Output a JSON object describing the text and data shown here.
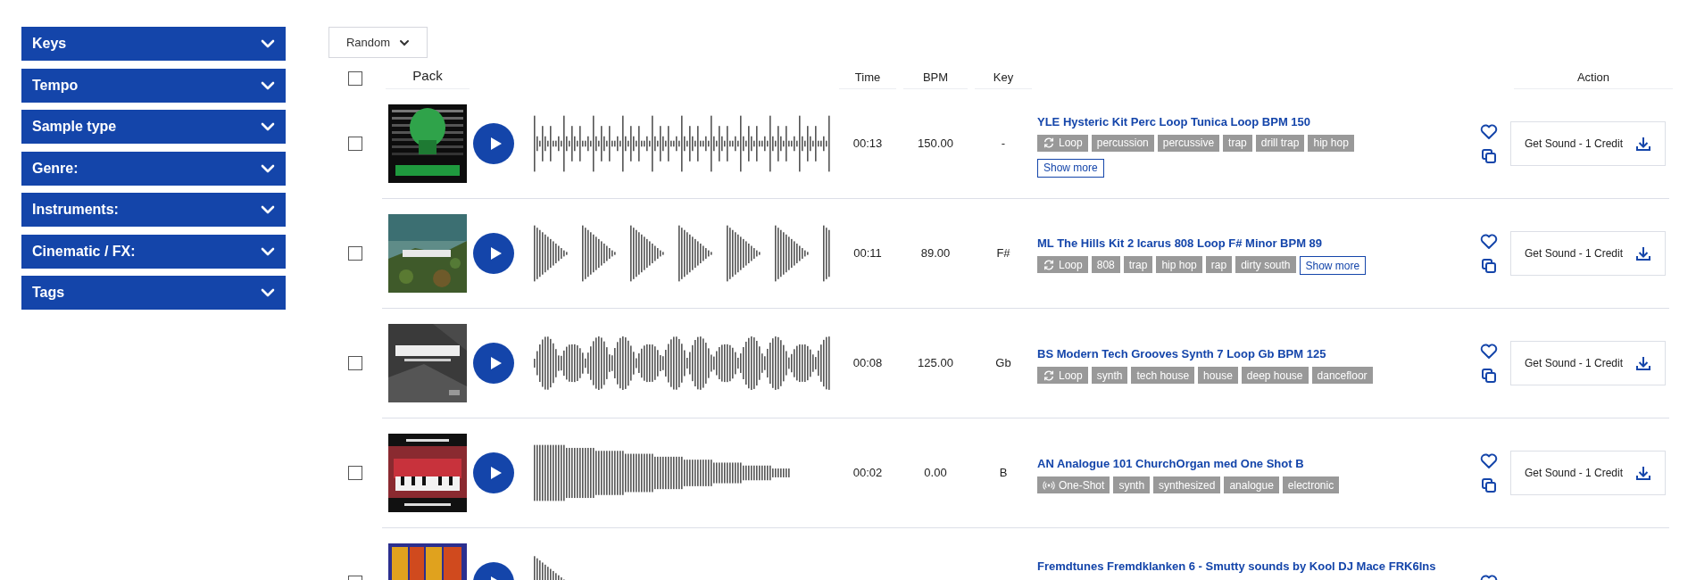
{
  "filters": [
    {
      "label": "Keys",
      "expanded": false
    },
    {
      "label": "Tempo",
      "expanded": false
    },
    {
      "label": "Sample type",
      "expanded": false
    },
    {
      "label": "Genre:",
      "expanded": false
    },
    {
      "label": "Instruments:",
      "expanded": false
    },
    {
      "label": "Cinematic / FX:",
      "expanded": false
    },
    {
      "label": "Tags",
      "expanded": false
    }
  ],
  "sort": {
    "value": "Random"
  },
  "table": {
    "select_all": {
      "checked": false
    },
    "columns": [
      "Pack",
      "Time",
      "BPM",
      "Key",
      "Action"
    ],
    "rows": [
      {
        "selected": false,
        "time": "00:13",
        "bpm": "150.00",
        "key": "-",
        "title": "YLE Hysteric Kit Perc Loop Tunica Loop BPM 150",
        "tags": [
          {
            "label": "Loop",
            "kind": "loop"
          },
          {
            "label": "percussion",
            "kind": "plain"
          },
          {
            "label": "percussive",
            "kind": "plain"
          },
          {
            "label": "trap",
            "kind": "plain"
          },
          {
            "label": "drill trap",
            "kind": "plain"
          },
          {
            "label": "hip hop",
            "kind": "plain"
          }
        ],
        "show_more": "Show more",
        "show_more_wrapped": true,
        "action": "Get Sound - 1 Credit"
      },
      {
        "selected": false,
        "time": "00:11",
        "bpm": "89.00",
        "key": "F#",
        "title": "ML The Hills Kit 2 Icarus 808 Loop F# Minor BPM 89",
        "tags": [
          {
            "label": "Loop",
            "kind": "loop"
          },
          {
            "label": "808",
            "kind": "plain"
          },
          {
            "label": "trap",
            "kind": "plain"
          },
          {
            "label": "hip hop",
            "kind": "plain"
          },
          {
            "label": "rap",
            "kind": "plain"
          },
          {
            "label": "dirty south",
            "kind": "plain"
          }
        ],
        "show_more": "Show more",
        "show_more_wrapped": false,
        "action": "Get Sound - 1 Credit"
      },
      {
        "selected": false,
        "time": "00:08",
        "bpm": "125.00",
        "key": "Gb",
        "title": "BS Modern Tech Grooves Synth 7 Loop Gb BPM 125",
        "tags": [
          {
            "label": "Loop",
            "kind": "loop"
          },
          {
            "label": "synth",
            "kind": "plain"
          },
          {
            "label": "tech house",
            "kind": "plain"
          },
          {
            "label": "house",
            "kind": "plain"
          },
          {
            "label": "deep house",
            "kind": "plain"
          },
          {
            "label": "dancefloor",
            "kind": "plain"
          }
        ],
        "action": "Get Sound - 1 Credit"
      },
      {
        "selected": false,
        "time": "00:02",
        "bpm": "0.00",
        "key": "B",
        "title": "AN Analogue 101 ChurchOrgan med One Shot B",
        "tags": [
          {
            "label": "One-Shot",
            "kind": "one-shot"
          },
          {
            "label": "synth",
            "kind": "plain"
          },
          {
            "label": "synthesized",
            "kind": "plain"
          },
          {
            "label": "analogue",
            "kind": "plain"
          },
          {
            "label": "electronic",
            "kind": "plain"
          }
        ],
        "action": "Get Sound - 1 Credit"
      },
      {
        "selected": false,
        "title": "Fremdtunes Fremdklanken 6 - Smutty sounds by Kool DJ Mace FRK6Ins"
      }
    ]
  }
}
